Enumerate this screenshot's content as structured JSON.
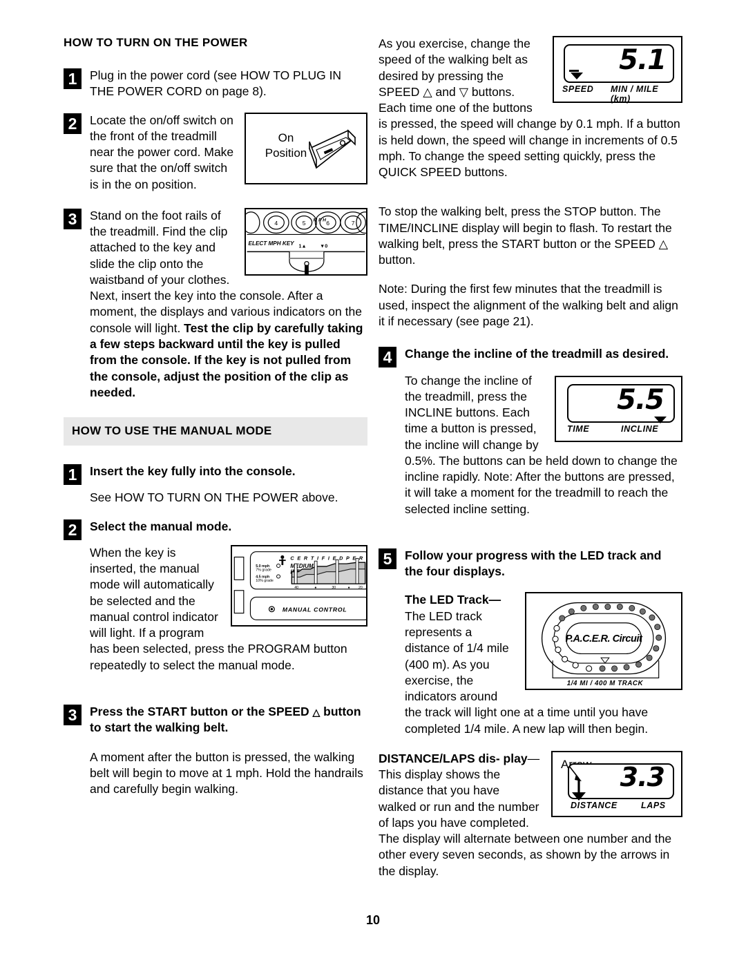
{
  "page": {
    "number": "10"
  },
  "left_column": {
    "section1": {
      "title": "HOW TO TURN ON THE POWER",
      "steps": [
        {
          "number": "1",
          "text": "Plug in the power cord (see HOW TO PLUG IN THE POWER CORD on page 8)."
        },
        {
          "number": "2",
          "text": "Locate the on/off switch on the front of the treadmill near the power cord. Make sure that the on/off switch is in the on position."
        },
        {
          "number": "3",
          "text_part1": "Stand on the foot rails of the treadmill. Find the clip attached to the key and slide the clip onto the waistband of your clothes. Next, insert the key into the console. After a moment, the displays and various indicators on the console will light. ",
          "text_bold": "Test the clip by carefully taking a few steps backward until the key is pulled from the console. If the key is not pulled from the console, adjust the position of the clip as needed."
        }
      ]
    },
    "figure_on_position": {
      "label_line1": "On",
      "label_line2": "Position"
    },
    "figure_console": {
      "button_labels": [
        "4",
        "5",
        "6",
        "7"
      ],
      "select_text": "ELECT MPH KEY",
      "mph_marks": [
        "1▲",
        "▼0"
      ]
    },
    "section2": {
      "title": "HOW TO USE THE MANUAL MODE",
      "steps": [
        {
          "number": "1",
          "heading": "Insert the key fully into the console.",
          "text": "See HOW TO TURN ON THE POWER above."
        },
        {
          "number": "2",
          "heading": "Select the manual mode.",
          "text": "When the key is inserted, the manual mode will automatically be selected and the manual control indicator will light. If a program has been selected, press the PROGRAM button repeatedly to select the manual mode."
        },
        {
          "number": "3",
          "heading_part1": "Press the START button or the SPEED ",
          "heading_symbol": "△",
          "heading_part2": " button to start the walking belt.",
          "text": "A moment after the button is pressed, the walking belt will begin to move at 1 mph. Hold the handrails and carefully begin walking."
        }
      ]
    },
    "figure_program_panel": {
      "certified_text": "C E R T I F I E D   P E R S O N A L",
      "intensity_line1": "MEDIUM",
      "intensity_line2": "INTENSITY",
      "speed_label1_line1": "5.0 mph",
      "speed_label1_line2": "7% grade",
      "speed_label2_line1": "4.5 mph",
      "speed_label2_line2": "10% grade",
      "axis_ticks": [
        "40",
        "30",
        "20"
      ],
      "manual_control_text": "MANUAL CONTROL"
    }
  },
  "right_column": {
    "speed_intro": "As you exercise, change the speed of the walking belt as desired by pressing the SPEED △ and ▽ buttons. Each time one of the buttons is pressed, the speed will change by 0.1 mph. If a button is held down, the speed will change in increments of 0.5 mph. To change the speed setting quickly, press the QUICK SPEED buttons.",
    "stop_paragraph": "To stop the walking belt, press the STOP button. The TIME/INCLINE display will begin to flash. To restart the walking belt, press the START button or the SPEED △ button.",
    "note_paragraph": "Note: During the first few minutes that the treadmill is used, inspect the alignment of the walking belt and align it if necessary (see page 21).",
    "figure_speed_display": {
      "value": "5.1",
      "caption_left": "SPEED",
      "caption_right": "MIN / MILE (km)"
    },
    "step4": {
      "number": "4",
      "heading": "Change the incline of the treadmill as desired.",
      "text": "To change the incline of the treadmill, press the INCLINE buttons. Each time a button is pressed, the incline will change by 0.5%. The buttons can be held down to change the incline rapidly. Note: After the buttons are pressed, it will take a moment for the treadmill to reach the selected incline setting."
    },
    "figure_incline_display": {
      "value": "5.5",
      "caption_left": "TIME",
      "caption_right": "INCLINE"
    },
    "step5": {
      "number": "5",
      "heading_line1": "Follow your progress with the LED track and",
      "heading_line2": "the four displays.",
      "led_track_title": "The LED Track—",
      "led_track_text": "The LED track represents a distance of 1/4 mile (400 m). As you exercise, the indicators around the track will light one at a time until you have completed 1/4 mile. A new lap will then begin.",
      "distance_title_part1": "DISTANCE/LAPS dis-",
      "distance_title_part2": "play",
      "distance_text": "—This display shows the distance that you have walked or run and the number of laps you have completed. The display will alternate between one number and the other every seven seconds, as shown by the arrows in the display."
    },
    "figure_led_track": {
      "brand": "P.A.C.E.R. Circuit",
      "caption": "1/4 MI / 400 M TRACK"
    },
    "figure_distance_display": {
      "arrow_label": "Arrow",
      "value": "3.3",
      "caption_left": "DISTANCE",
      "caption_right": "LAPS"
    }
  }
}
